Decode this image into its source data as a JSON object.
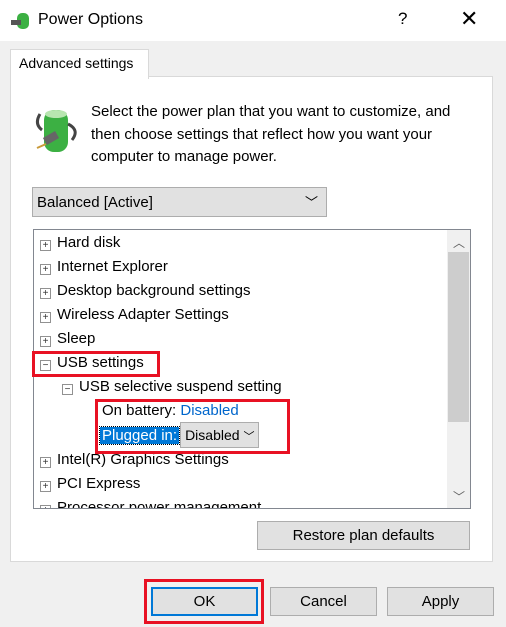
{
  "window": {
    "title": "Power Options",
    "help": "?",
    "close": "✕"
  },
  "tab": "Advanced settings",
  "description": "Select the power plan that you want to customize, and then choose settings that reflect how you want your computer to manage power.",
  "plan_select": {
    "value": "Balanced [Active]"
  },
  "tree": {
    "items": [
      {
        "label": "Hard disk",
        "expanded": false
      },
      {
        "label": "Internet Explorer",
        "expanded": false
      },
      {
        "label": "Desktop background settings",
        "expanded": false
      },
      {
        "label": "Wireless Adapter Settings",
        "expanded": false
      },
      {
        "label": "Sleep",
        "expanded": false
      },
      {
        "label": "USB settings",
        "expanded": true
      },
      {
        "label": "USB selective suspend setting",
        "expanded": true
      },
      {
        "label": "Intel(R) Graphics Settings",
        "expanded": false
      },
      {
        "label": "PCI Express",
        "expanded": false
      },
      {
        "label": "Processor power management",
        "expanded": false
      }
    ],
    "on_battery_label": "On battery:",
    "on_battery_value": "Disabled",
    "plugged_in_label": "Plugged in:",
    "plugged_in_value": "Disabled"
  },
  "buttons": {
    "restore": "Restore plan defaults",
    "ok": "OK",
    "cancel": "Cancel",
    "apply": "Apply"
  },
  "colors": {
    "highlight": "#e81123",
    "selection": "#0078d7",
    "link": "#0066cc"
  }
}
